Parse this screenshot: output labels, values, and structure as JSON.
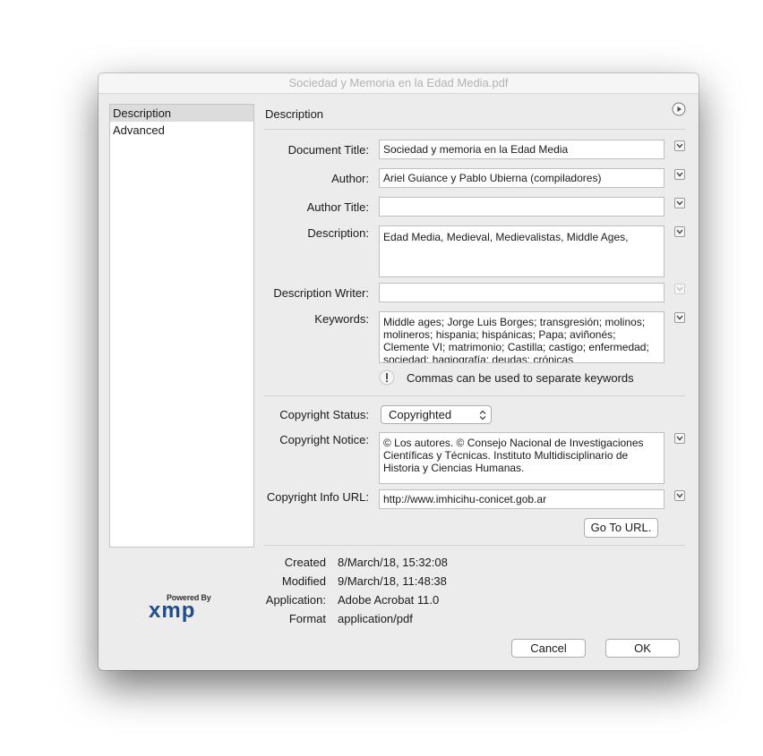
{
  "window": {
    "title": "Sociedad y Memoria en la Edad Media.pdf"
  },
  "sidebar": {
    "items": [
      {
        "label": "Description"
      },
      {
        "label": "Advanced"
      }
    ]
  },
  "section": {
    "title": "Description"
  },
  "fields": {
    "document_title": {
      "label": "Document Title:",
      "value": "Sociedad y memoria en la Edad Media"
    },
    "author": {
      "label": "Author:",
      "value": "Ariel Guiance y Pablo Ubierna (compiladores)"
    },
    "author_title": {
      "label": "Author Title:",
      "value": ""
    },
    "description": {
      "label": "Description:",
      "value": "Edad Media, Medieval, Medievalistas, Middle Ages,"
    },
    "description_writer": {
      "label": "Description Writer:",
      "value": ""
    },
    "keywords": {
      "label": "Keywords:",
      "value": "Middle ages; Jorge Luis Borges; transgresión; molinos; molineros; hispania; hispánicas; Papa; aviñonés; Clemente VI; matrimonio; Castilla; castigo; enfermedad; sociedad; hagiografía; deudas; crónicas"
    },
    "keywords_hint": "Commas can be used to separate keywords",
    "copyright_status": {
      "label": "Copyright Status:",
      "value": "Copyrighted"
    },
    "copyright_notice": {
      "label": "Copyright Notice:",
      "value": "© Los autores. © Consejo Nacional de Investigaciones Científicas y Técnicas. Instituto Multidisciplinario de Historia y Ciencias Humanas."
    },
    "copyright_url": {
      "label": "Copyright Info URL:",
      "value": "http://www.imhicihu-conicet.gob.ar"
    }
  },
  "goto_url_label": "Go To URL.",
  "metadata": {
    "created": {
      "label": "Created",
      "value": "8/March/18, 15:32:08"
    },
    "modified": {
      "label": "Modified",
      "value": "9/March/18, 11:48:38"
    },
    "application": {
      "label": "Application:",
      "value": "Adobe Acrobat 11.0"
    },
    "format": {
      "label": "Format",
      "value": "application/pdf"
    }
  },
  "logo": {
    "powered_by": "Powered By",
    "name": "xmp"
  },
  "buttons": {
    "cancel": "Cancel",
    "ok": "OK"
  },
  "colors": {
    "xmp_blue": "#1f4d8c"
  }
}
